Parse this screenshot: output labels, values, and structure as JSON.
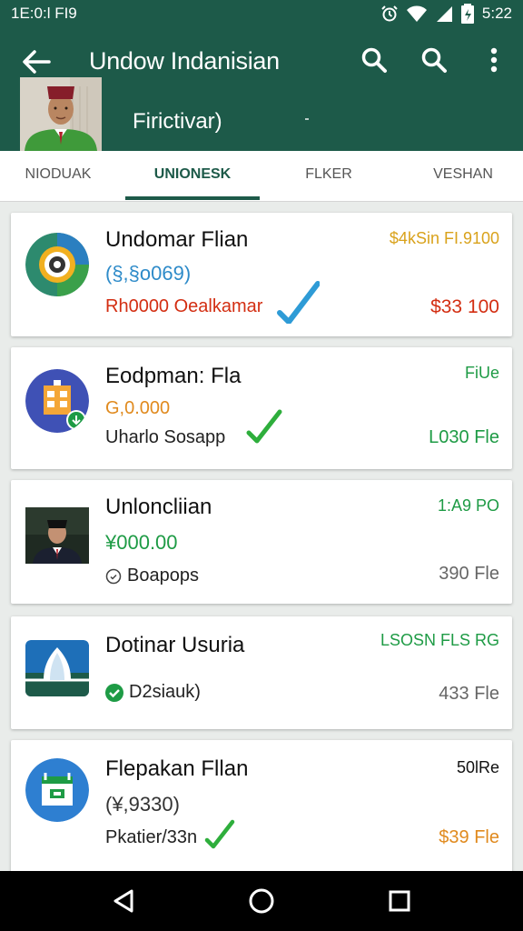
{
  "status": {
    "left_text": "1E:0:l FI9",
    "time": "5:22",
    "icons": [
      "alarm-icon",
      "wifi-icon",
      "signal-icon",
      "battery-icon"
    ]
  },
  "appbar": {
    "title": "Undow Indanisian",
    "subtitle": "Firictivar)",
    "icons": [
      "back-arrow-icon",
      "search-icon",
      "search-icon",
      "more-vert-icon"
    ]
  },
  "tabs": [
    {
      "label": "NIODUAK",
      "active": false
    },
    {
      "label": "UNIONESK",
      "active": true
    },
    {
      "label": "FLKER",
      "active": false
    },
    {
      "label": "VESHAN",
      "active": false
    }
  ],
  "cards": [
    {
      "title": "Undomar Flian",
      "line2": "(§,§o069)",
      "line3": "Rh0000 Oealkamar",
      "right_top": "$4kSin FI.9100",
      "right_bottom": "$33 100",
      "icon": "target-app-icon"
    },
    {
      "title": "Eodpman: Fla",
      "line2": "G,0.000",
      "line3": "Uharlo Sosapp",
      "right_top": "FiUe",
      "right_bottom": "L030 Fle",
      "icon": "building-app-icon"
    },
    {
      "title": "Unloncliian",
      "line2": "¥000.00",
      "line3": "Boapops",
      "right_top": "1:A9 PO",
      "right_bottom": "390 Fle",
      "icon": "person-photo"
    },
    {
      "title": "Dotinar Usuria",
      "line2": "D2siauk)",
      "right_top": "LSOSN FLS RG",
      "right_bottom": "433 Fle",
      "icon": "monument-app-icon"
    },
    {
      "title": "Flepakan Fllan",
      "line2": "(¥,9330)",
      "line3": "Pkatier/33n",
      "right_top": "50lRe",
      "right_bottom": "$39 Fle",
      "icon": "calendar-app-icon"
    }
  ],
  "colors": {
    "primary": "#1d5a49",
    "green": "#1e9b45",
    "red": "#d32e12",
    "orange": "#e08a1e",
    "blue": "#2e8bc9",
    "gold": "#d9a21b"
  },
  "navbar": {
    "icons": [
      "back-triangle-icon",
      "home-circle-icon",
      "recents-square-icon"
    ]
  }
}
